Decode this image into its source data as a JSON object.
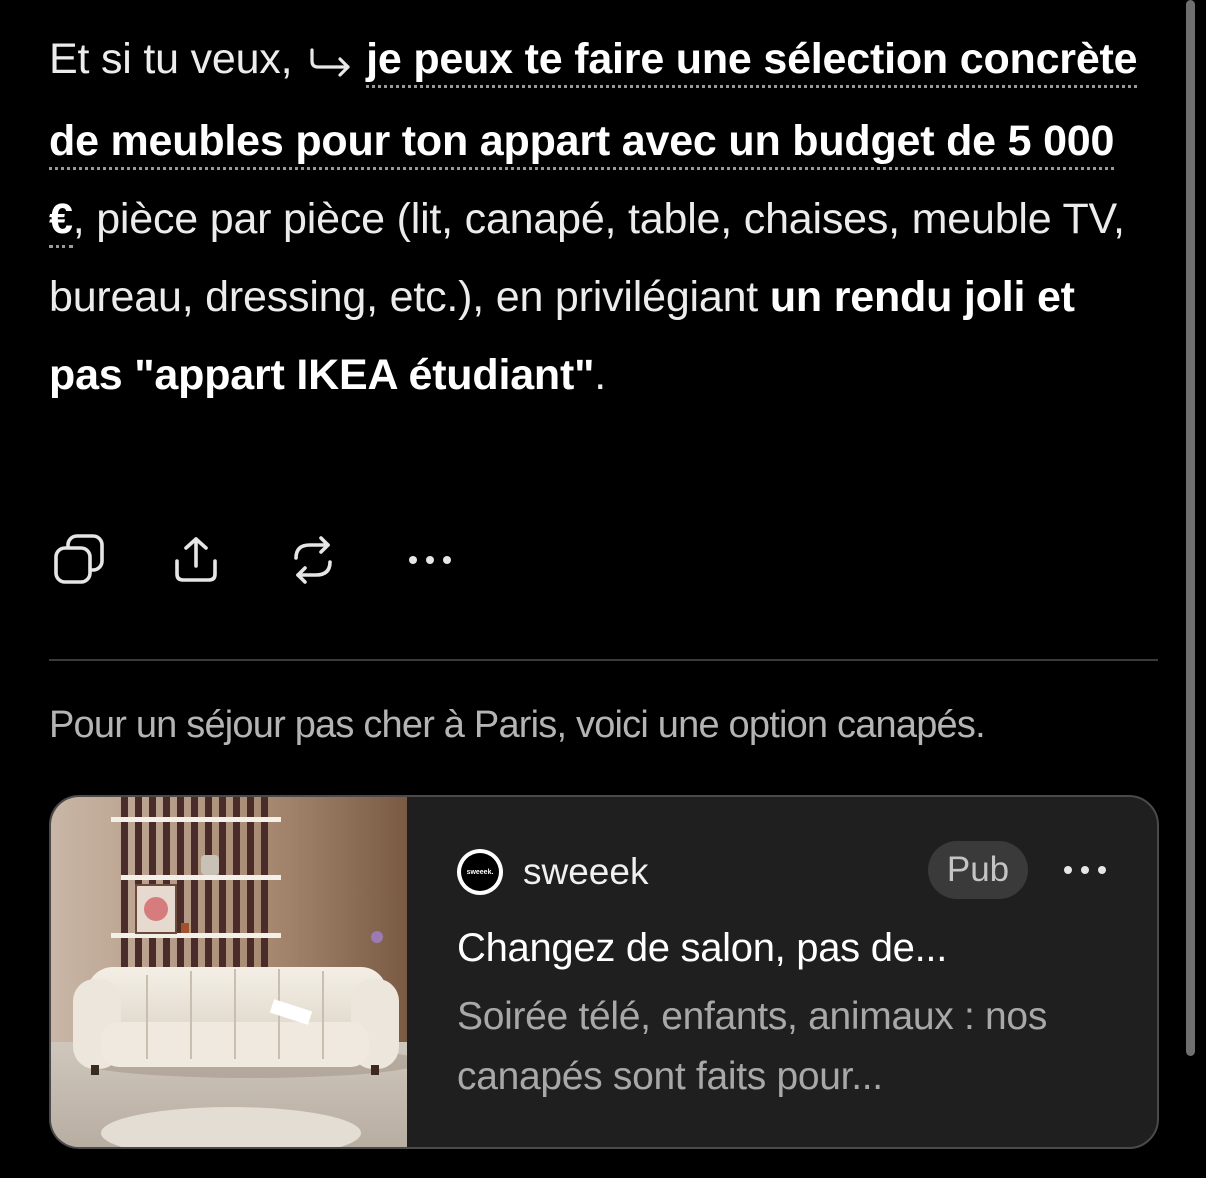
{
  "message": {
    "prefix": "Et si tu veux,",
    "arrow_icon": "return-arrow-icon",
    "link_text": "je peux te faire une sélection concrète de meubles pour ton appart avec un budget de 5 000 €",
    "after_link": ", pièce par pièce (lit, canapé, table, chaises, meuble TV, bureau, dressing, etc.), en privilégiant ",
    "bold_text": "un rendu joli et pas \"appart IKEA étudiant\"",
    "suffix": "."
  },
  "actions": [
    {
      "name": "copy",
      "icon": "copy-icon"
    },
    {
      "name": "share",
      "icon": "share-icon"
    },
    {
      "name": "regenerate",
      "icon": "refresh-icon"
    },
    {
      "name": "more",
      "icon": "more-icon"
    }
  ],
  "ad_intro": "Pour un séjour pas cher à Paris, voici une option canapés.",
  "ad": {
    "logo_text": "sweeek.",
    "brand": "sweeek",
    "badge": "Pub",
    "title": "Changez de salon, pas de...",
    "description": "Soirée télé, enfants, animaux : nos canapés sont faits pour...",
    "image": "sofa-living-room-photo"
  },
  "colors": {
    "background": "#000000",
    "text": "#ececec",
    "muted": "#b4b4b4",
    "card_bg": "#1f1f1f",
    "card_border": "#4a4a4a"
  }
}
